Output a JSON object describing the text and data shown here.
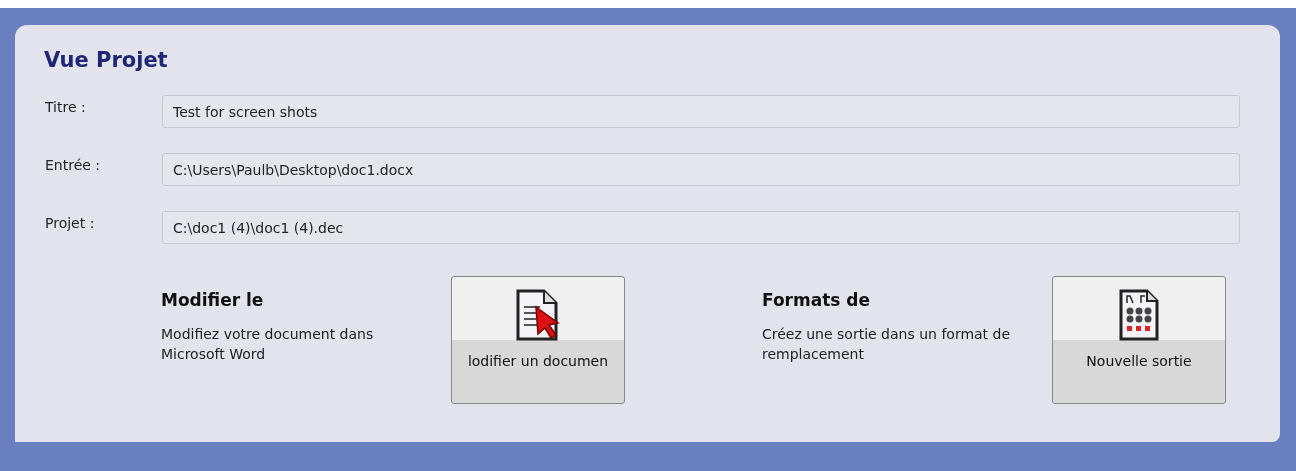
{
  "panel": {
    "title": "Vue Projet"
  },
  "fields": [
    {
      "label": "Titre :",
      "value": "Test for screen shots"
    },
    {
      "label": "Entrée :",
      "value": "C:\\Users\\Paulb\\Desktop\\doc1.docx"
    },
    {
      "label": "Projet :",
      "value": "C:\\doc1 (4)\\doc1 (4).dec"
    }
  ],
  "actions": [
    {
      "kind": "edit",
      "heading": "Modifier le",
      "description": "Modifiez votre document dans Microsoft Word",
      "button": "lodifier un documen"
    },
    {
      "kind": "output",
      "heading": "Formats de",
      "description": "Créez une sortie dans un format de remplacement",
      "button": "Nouvelle sortie"
    }
  ]
}
